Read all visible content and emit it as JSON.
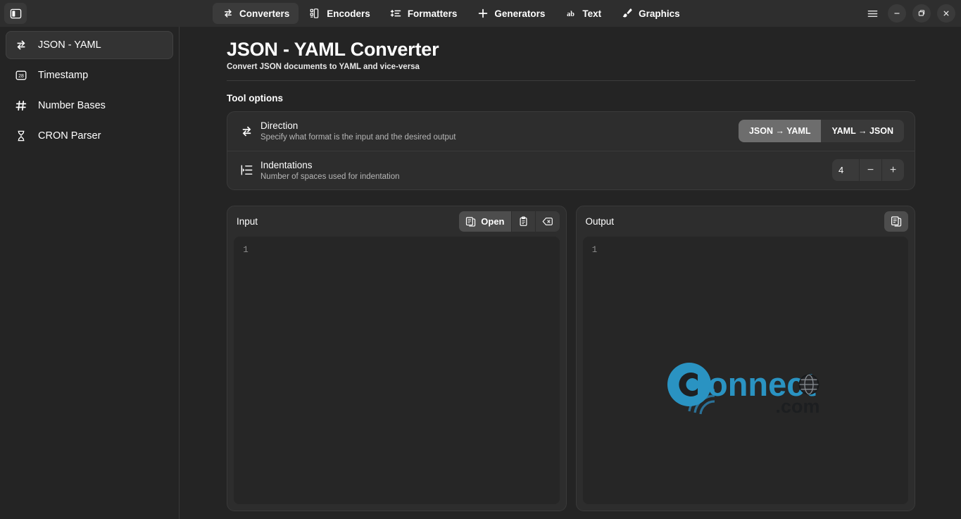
{
  "window": {
    "sidebar_toggle_label": "Toggle sidebar",
    "menu_label": "Main menu",
    "minimize_label": "Minimize",
    "maximize_label": "Restore",
    "close_label": "Close"
  },
  "tabs": [
    {
      "label": "Converters",
      "icon": "convert-arrows-icon",
      "active": true
    },
    {
      "label": "Encoders",
      "icon": "barcode-icon",
      "active": false
    },
    {
      "label": "Formatters",
      "icon": "format-list-icon",
      "active": false
    },
    {
      "label": "Generators",
      "icon": "plus-icon",
      "active": false
    },
    {
      "label": "Text",
      "icon": "ab-text-icon",
      "active": false
    },
    {
      "label": "Graphics",
      "icon": "brush-icon",
      "active": false
    }
  ],
  "sidebar": {
    "items": [
      {
        "label": "JSON - YAML",
        "icon": "convert-arrows-icon",
        "active": true
      },
      {
        "label": "Timestamp",
        "icon": "calendar-28-icon",
        "active": false
      },
      {
        "label": "Number Bases",
        "icon": "hash-icon",
        "active": false
      },
      {
        "label": "CRON Parser",
        "icon": "hourglass-icon",
        "active": false
      }
    ]
  },
  "page": {
    "title": "JSON - YAML Converter",
    "subtitle": "Convert JSON documents to YAML and vice-versa",
    "tool_options_label": "Tool options"
  },
  "options": {
    "direction": {
      "title": "Direction",
      "description": "Specify what format is the input and the desired output",
      "icon": "convert-arrows-icon",
      "choices": [
        {
          "label": "JSON → YAML",
          "selected": true
        },
        {
          "label": "YAML → JSON",
          "selected": false
        }
      ]
    },
    "indentations": {
      "title": "Indentations",
      "description": "Number of spaces used for indentation",
      "icon": "indent-icon",
      "value": "4",
      "decrement_label": "−",
      "increment_label": "+"
    }
  },
  "editors": {
    "input": {
      "title": "Input",
      "open_label": "Open",
      "open_icon": "open-file-icon",
      "paste_icon": "paste-clipboard-icon",
      "clear_icon": "clear-backspace-icon",
      "line_numbers": "1",
      "content": ""
    },
    "output": {
      "title": "Output",
      "copy_icon": "copy-clipboard-icon",
      "line_numbers": "1",
      "content": "",
      "watermark_text": "Connect",
      "watermark_suffix": ".com"
    }
  },
  "colors": {
    "window_bg": "#242424",
    "titlebar_bg": "#2e2e2e",
    "card_bg": "#2d2d2d",
    "editor_bg": "#262626",
    "border": "#3a3a3a",
    "accent_selected": "#6d6d6d",
    "watermark_blue": "#2ba6de"
  }
}
